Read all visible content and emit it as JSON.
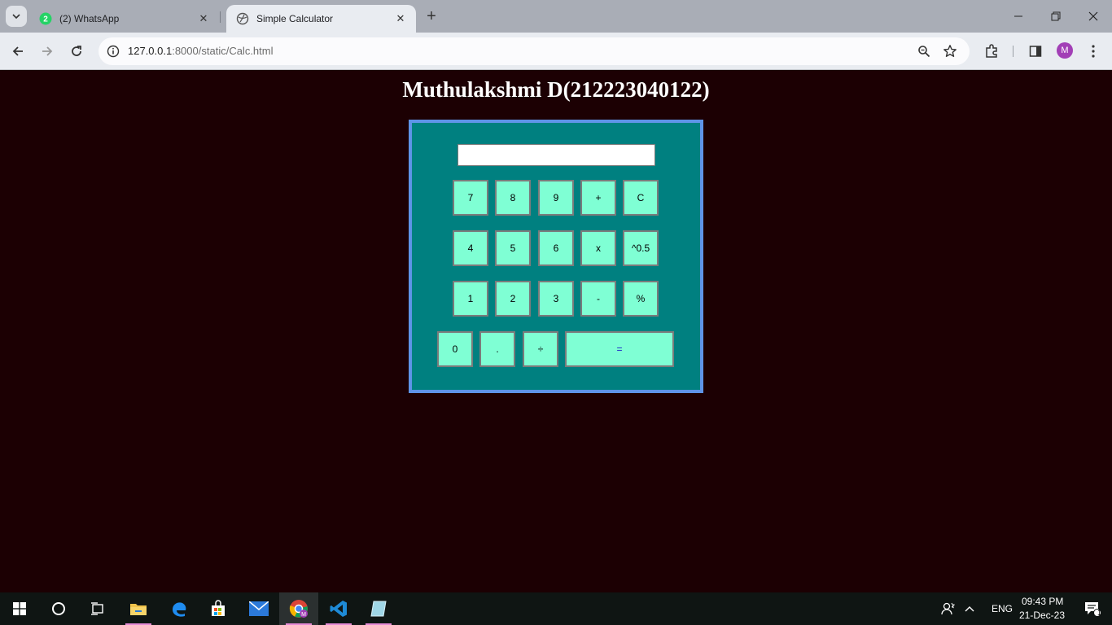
{
  "browser": {
    "tabs": [
      {
        "title": "(2) WhatsApp",
        "badge": "2",
        "icon": "whatsapp-icon"
      },
      {
        "title": "Simple Calculator",
        "icon": "globe-icon"
      }
    ],
    "url_host": "127.0.0.1",
    "url_rest": ":8000/static/Calc.html",
    "profile_initial": "M"
  },
  "page": {
    "title": "Muthulakshmi D(212223040122)"
  },
  "calculator": {
    "display_value": "",
    "keys": {
      "k7": "7",
      "k8": "8",
      "k9": "9",
      "plus": "+",
      "clear": "C",
      "k4": "4",
      "k5": "5",
      "k6": "6",
      "multiply": "x",
      "sqrt": "^0.5",
      "k1": "1",
      "k2": "2",
      "k3": "3",
      "minus": "-",
      "percent": "%",
      "k0": "0",
      "dot": ".",
      "divide": "÷",
      "equals": "="
    },
    "colors": {
      "panel": "#008080",
      "border": "#5e94e8",
      "key": "#7fffd4",
      "page_bg": "#1c0003"
    }
  },
  "taskbar": {
    "language": "ENG",
    "time": "09:43 PM",
    "date": "21-Dec-23",
    "notifications": "1"
  }
}
